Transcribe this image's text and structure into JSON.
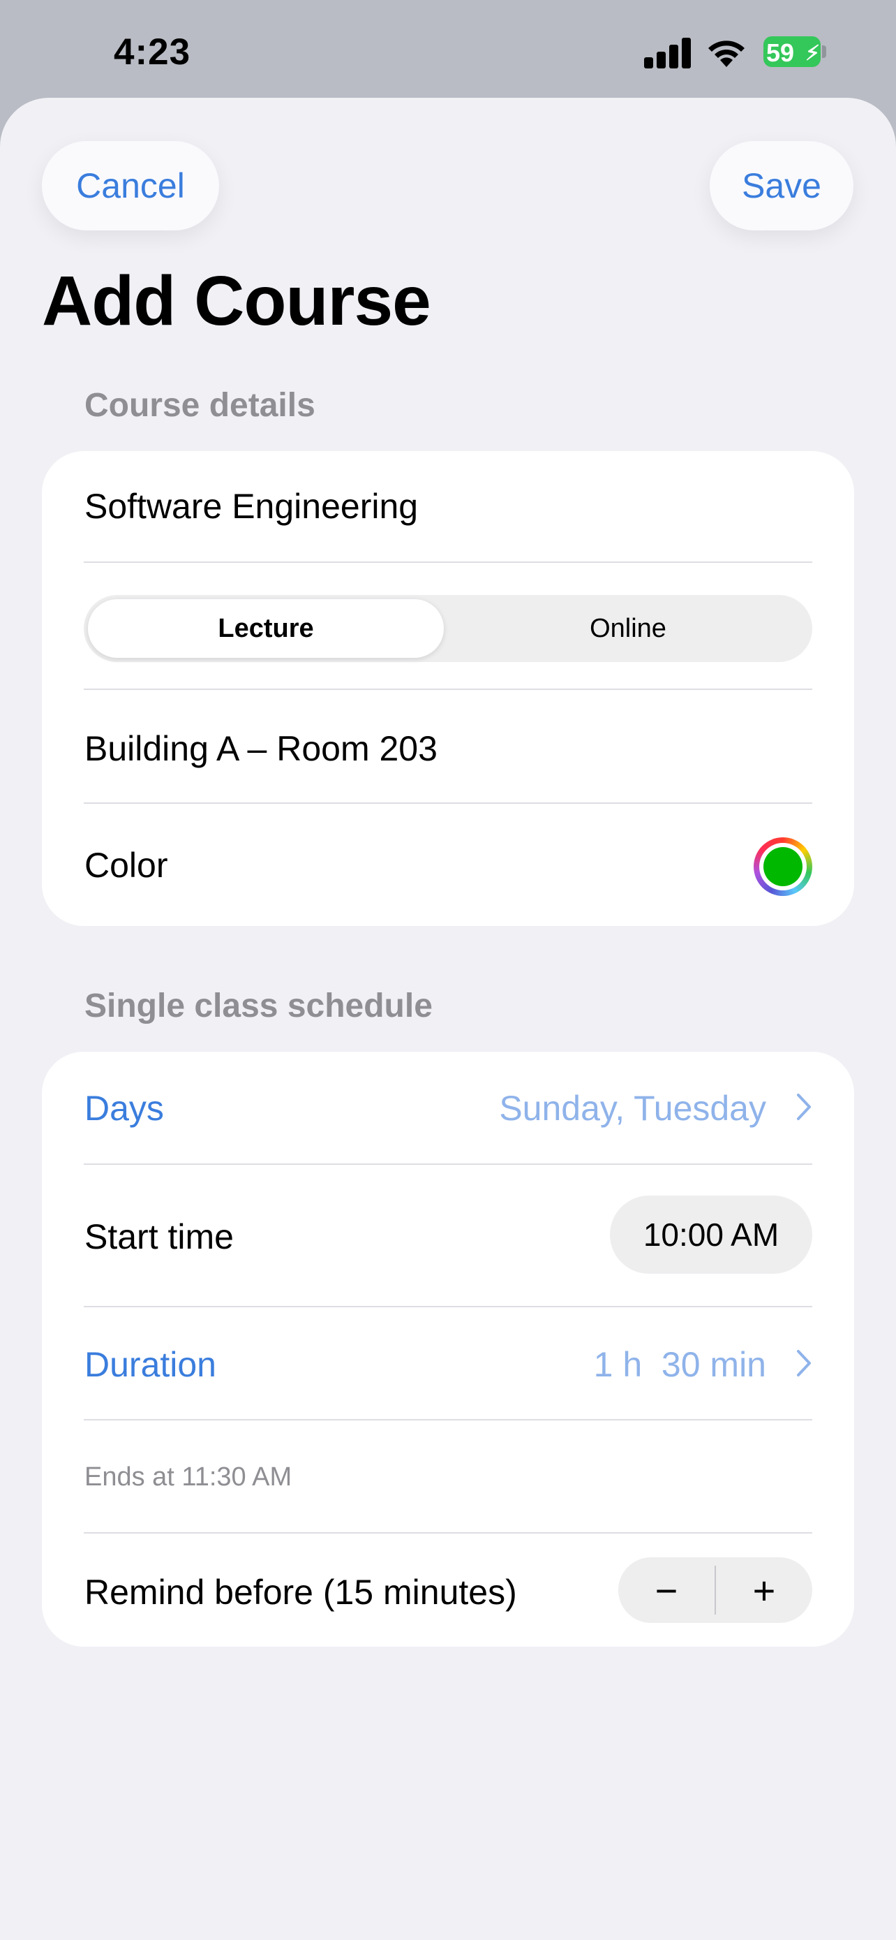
{
  "status_bar": {
    "time": "4:23",
    "battery_percent": "59"
  },
  "nav": {
    "cancel_label": "Cancel",
    "save_label": "Save",
    "title": "Add Course"
  },
  "course_details": {
    "header": "Course details",
    "name_value": "Software Engineering",
    "class_type": {
      "options": [
        "Lecture",
        "Online"
      ],
      "selected": "Lecture"
    },
    "location_value": "Building A – Room 203",
    "color_label": "Color",
    "selected_color": "#00b800"
  },
  "schedule": {
    "header": "Single class schedule",
    "days_label": "Days",
    "days_value": "Sunday, Tuesday",
    "start_time_label": "Start time",
    "start_time_value": "10:00 AM",
    "duration_label": "Duration",
    "duration_value": "1 h  30 min",
    "ends_at_note": "Ends at 11:30 AM",
    "remind_label": "Remind before (15 minutes)",
    "stepper_minus": "−",
    "stepper_plus": "+"
  },
  "colors": {
    "accent": "#3a7ddd",
    "accent_light": "#8fb3ea",
    "sheet_background": "#f0f0f5",
    "battery_green": "#34c759"
  }
}
